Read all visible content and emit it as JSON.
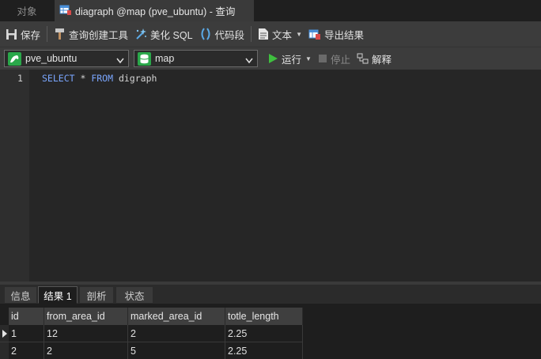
{
  "tabs": {
    "objects": "对象",
    "query": "diagraph @map (pve_ubuntu) - 查询"
  },
  "toolbar": {
    "save": "保存",
    "query_builder": "查询创建工具",
    "beautify_sql": "美化 SQL",
    "code_snippet": "代码段",
    "text": "文本",
    "export_results": "导出结果"
  },
  "connection": {
    "selected": "pve_ubuntu"
  },
  "database": {
    "selected": "map"
  },
  "run": {
    "run": "运行",
    "stop": "停止",
    "explain": "解释"
  },
  "editor": {
    "line_number": "1",
    "tokens": [
      "SELECT",
      " * ",
      "FROM",
      " digraph"
    ]
  },
  "result_tabs": [
    "信息",
    "结果 1",
    "剖析",
    "状态"
  ],
  "grid": {
    "columns": [
      "id",
      "from_area_id",
      "marked_area_id",
      "totle_length"
    ],
    "rows": [
      [
        "1",
        "12",
        "2",
        "2.25"
      ],
      [
        "2",
        "2",
        "5",
        "2.25"
      ]
    ]
  },
  "colors": {
    "accent_green": "#3fbf3f",
    "keyword_blue": "#7aa6ff",
    "grid_icon_blue": "#4a8fd8",
    "grid_icon_red": "#d84a4a"
  }
}
